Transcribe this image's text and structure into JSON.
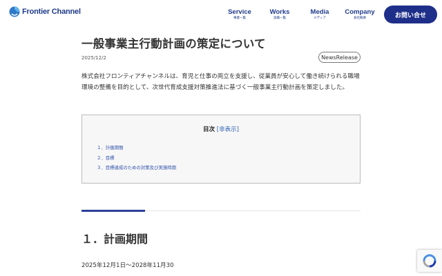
{
  "brand": {
    "name": "Frontier Channel"
  },
  "nav": {
    "items": [
      {
        "en": "Service",
        "jp": "事業一覧"
      },
      {
        "en": "Works",
        "jp": "実績一覧"
      },
      {
        "en": "Media",
        "jp": "メディア"
      },
      {
        "en": "Company",
        "jp": "会社概要"
      }
    ],
    "contact_label": "お問い合せ"
  },
  "article": {
    "title": "一般事業主行動計画の策定について",
    "date": "2025/12/2",
    "tag": "NewsRelease",
    "intro": "株式会社フロンティアチャンネルは、育児と仕事の両立を支援し、従業員が安心して働き続けられる職場環境の整備を目的として、次世代育成支援対策推進法に基づく一般事業主行動計画を策定しました。"
  },
  "toc": {
    "title": "目次",
    "toggle": "[非表示]",
    "items": [
      "１．計画期間",
      "２．目標",
      "３．目標達成のための対策及び実施時期"
    ]
  },
  "section1": {
    "number": "１．",
    "heading": "計画期間",
    "text": "2025年12月1日〜2028年11月30"
  },
  "colors": {
    "brand": "#1f3a8a",
    "button": "#1e2f8a",
    "link": "#2b5fb3",
    "accent_bar": "#2a3f9a"
  },
  "icons": {
    "logo": "frontier-channel-logo-icon",
    "recaptcha": "recaptcha-icon"
  }
}
